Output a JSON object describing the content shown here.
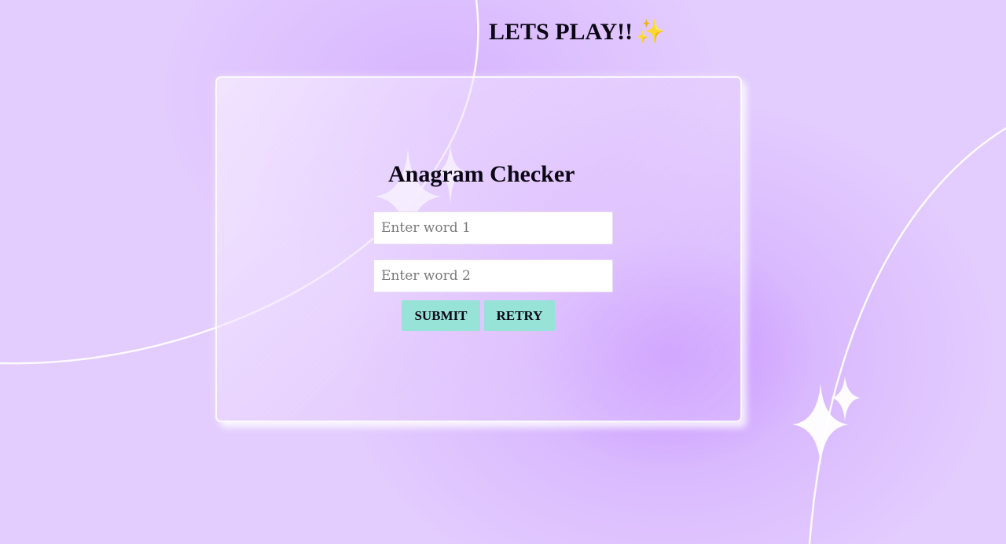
{
  "header": {
    "title": "LETS PLAY!!",
    "sparkle": "✨"
  },
  "card": {
    "title": "Anagram Checker",
    "inputs": [
      {
        "placeholder": "Enter word 1",
        "value": ""
      },
      {
        "placeholder": "Enter word 2",
        "value": ""
      }
    ],
    "buttons": {
      "submit_label": "SUBMIT",
      "retry_label": "RETRY"
    }
  },
  "colors": {
    "background": "#e3ccfe",
    "glow": "#c48cff",
    "button": "#97e3d8",
    "text": "#0b0714",
    "sparkle_emoji": "#f2b63c"
  },
  "icons": [
    "sparkle-emoji-icon",
    "star-sparkle-icon"
  ]
}
